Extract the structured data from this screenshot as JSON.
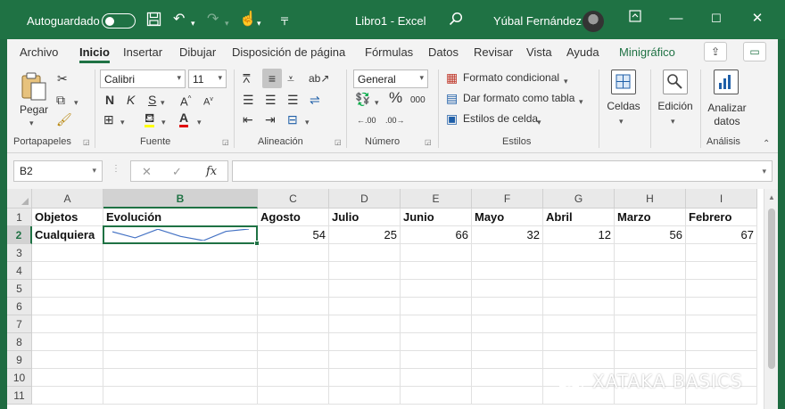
{
  "titlebar": {
    "autosave_label": "Autoguardado",
    "doc_title": "Libro1  -  Excel",
    "user_name": "Yúbal Fernández"
  },
  "menu": {
    "tabs": [
      "Archivo",
      "Inicio",
      "Insertar",
      "Dibujar",
      "Disposición de página",
      "Fórmulas",
      "Datos",
      "Revisar",
      "Vista",
      "Ayuda",
      "Minigráfico"
    ],
    "active_tab": "Inicio"
  },
  "ribbon": {
    "clipboard": {
      "paste_label": "Pegar",
      "group_label": "Portapapeles"
    },
    "font": {
      "font_name": "Calibri",
      "font_size": "11",
      "bold": "N",
      "italic": "K",
      "underline": "S",
      "group_label": "Fuente"
    },
    "alignment": {
      "group_label": "Alineación"
    },
    "number": {
      "format": "General",
      "percent": "%",
      "group_label": "Número"
    },
    "styles": {
      "conditional": "Formato condicional",
      "table": "Dar formato como tabla",
      "cell_styles": "Estilos de celda",
      "group_label": "Estilos"
    },
    "cells": {
      "label": "Celdas"
    },
    "editing": {
      "label": "Edición"
    },
    "analysis": {
      "label_line1": "Analizar",
      "label_line2": "datos",
      "group_label": "Análisis"
    }
  },
  "formula_bar": {
    "name_box": "B2",
    "fx": "fx",
    "value": ""
  },
  "sheet": {
    "columns": [
      "A",
      "B",
      "C",
      "D",
      "E",
      "F",
      "G",
      "H",
      "I"
    ],
    "rows": [
      "1",
      "2",
      "3",
      "4",
      "5",
      "6",
      "7",
      "8",
      "9",
      "10",
      "11"
    ],
    "selected_cell": "B2",
    "header_row": [
      "Objetos",
      "Evolución",
      "Agosto",
      "Julio",
      "Junio",
      "Mayo",
      "Abril",
      "Marzo",
      "Febrero"
    ],
    "data_row": {
      "label": "Cualquiera",
      "values": [
        54,
        25,
        66,
        32,
        12,
        56,
        67
      ]
    }
  },
  "colors": {
    "excel_green": "#1f7244",
    "sparkline": "#4472c4"
  },
  "watermark": {
    "text": "XATAKA BASICS"
  }
}
